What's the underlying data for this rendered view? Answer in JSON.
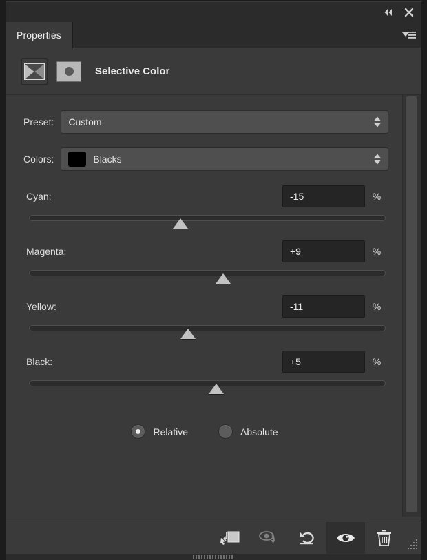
{
  "window": {
    "collapse_icon": "double-chevron-left-icon",
    "close_icon": "close-icon"
  },
  "tabs": [
    {
      "label": "Properties",
      "active": true
    }
  ],
  "panel_menu_icon": "panel-menu-icon",
  "adjustment": {
    "type_icon": "selective-color-icon",
    "mask_icon": "layer-mask-thumbnail",
    "title": "Selective Color"
  },
  "fields": {
    "preset_label": "Preset:",
    "preset_value": "Custom",
    "colors_label": "Colors:",
    "colors_value": "Blacks",
    "colors_swatch": "#000000"
  },
  "sliders": [
    {
      "label": "Cyan:",
      "value": "-15",
      "unit": "%",
      "percent": 42.5
    },
    {
      "label": "Magenta:",
      "value": "+9",
      "unit": "%",
      "percent": 54.5
    },
    {
      "label": "Yellow:",
      "value": "-11",
      "unit": "%",
      "percent": 44.5
    },
    {
      "label": "Black:",
      "value": "+5",
      "unit": "%",
      "percent": 52.5
    }
  ],
  "method": {
    "relative_label": "Relative",
    "absolute_label": "Absolute",
    "selected": "Relative"
  },
  "footer": {
    "clip_icon": "clip-to-layer-icon",
    "preview_previous_icon": "view-previous-state-icon",
    "reset_icon": "reset-icon",
    "visibility_icon": "eye-visibility-icon",
    "delete_icon": "trash-icon",
    "resize_icon": "resize-grip-icon"
  },
  "colors": {
    "panel_bg": "#3a3a3a",
    "chrome_bg": "#2b2b2b",
    "field_bg": "#252525",
    "text": "#e6e6e6"
  }
}
